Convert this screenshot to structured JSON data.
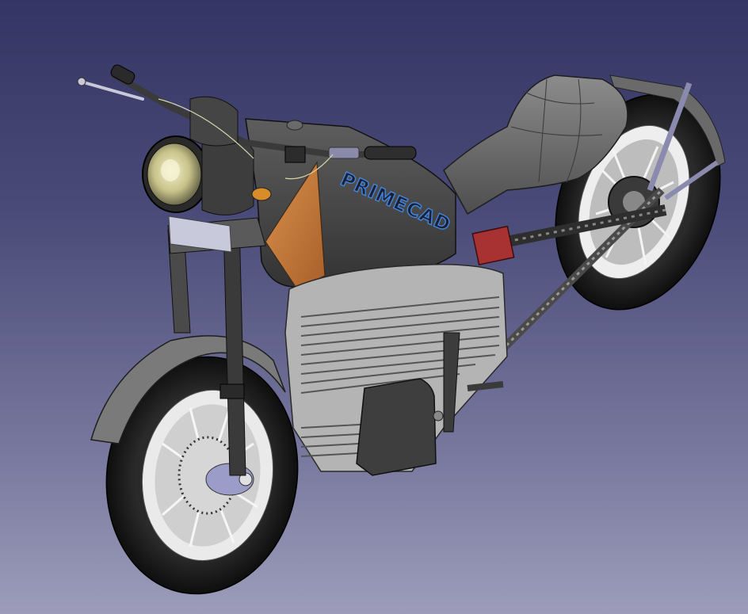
{
  "viewport": {
    "background_top": "#343564",
    "background_bottom": "#9c9cba"
  },
  "model": {
    "tank_logo": "PRIMECAD",
    "colors": {
      "body": "#4a4a4a",
      "tank_panel": "#c47a3a",
      "metal": "#d0d0d0",
      "tire": "#1c1c1c",
      "logo_outline": "#3f86e0",
      "battery": "#a83232"
    }
  }
}
